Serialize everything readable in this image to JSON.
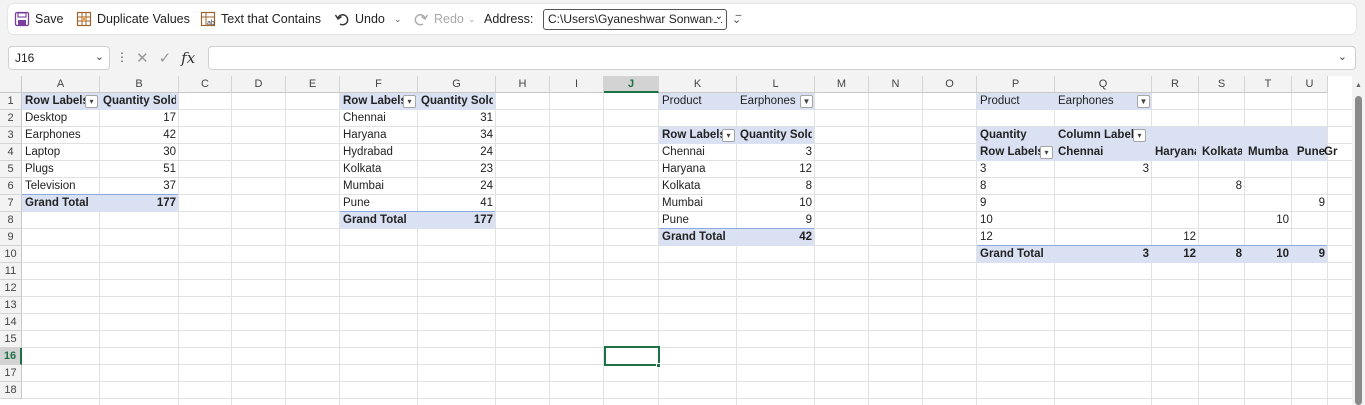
{
  "toolbar": {
    "save": "Save",
    "duplicate_values": "Duplicate Values",
    "text_contains": "Text that Contains",
    "undo": "Undo",
    "redo": "Redo",
    "address_label": "Address:",
    "address_value": "C:\\Users\\Gyaneshwar Sonwane\\"
  },
  "formula_bar": {
    "name_box": "J16",
    "formula": ""
  },
  "columns": [
    "A",
    "B",
    "C",
    "D",
    "E",
    "F",
    "G",
    "H",
    "I",
    "J",
    "K",
    "L",
    "M",
    "N",
    "O",
    "P",
    "Q",
    "R",
    "S",
    "T",
    "U"
  ],
  "rows": [
    "1",
    "2",
    "3",
    "4",
    "5",
    "6",
    "7",
    "8",
    "9",
    "10",
    "11",
    "12",
    "13",
    "14",
    "15",
    "16",
    "17",
    "18"
  ],
  "selected_cell": {
    "column": "J",
    "row": "16"
  },
  "pivot1": {
    "header": [
      "Row Labels",
      "Quantity Sold"
    ],
    "rows": [
      [
        "Desktop",
        "17"
      ],
      [
        "Earphones",
        "42"
      ],
      [
        "Laptop",
        "30"
      ],
      [
        "Plugs",
        "51"
      ],
      [
        "Television",
        "37"
      ]
    ],
    "total": [
      "Grand Total",
      "177"
    ]
  },
  "pivot2": {
    "header": [
      "Row Labels",
      "Quantity Sold"
    ],
    "rows": [
      [
        "Chennai",
        "31"
      ],
      [
        "Haryana",
        "34"
      ],
      [
        "Hydrabad",
        "24"
      ],
      [
        "Kolkata",
        "23"
      ],
      [
        "Mumbai",
        "24"
      ],
      [
        "Pune",
        "41"
      ]
    ],
    "total": [
      "Grand Total",
      "177"
    ]
  },
  "pivot3": {
    "filter": [
      "Product",
      "Earphones"
    ],
    "header": [
      "Row Labels",
      "Quantity Sold"
    ],
    "rows": [
      [
        "Chennai",
        "3"
      ],
      [
        "Haryana",
        "12"
      ],
      [
        "Kolkata",
        "8"
      ],
      [
        "Mumbai",
        "10"
      ],
      [
        "Pune",
        "9"
      ]
    ],
    "total": [
      "Grand Total",
      "42"
    ]
  },
  "pivot4": {
    "filter": [
      "Product",
      "Earphones"
    ],
    "value_label": "Quantity",
    "column_labels": "Column Labels",
    "row_labels": "Row Labels",
    "columns": [
      "Chennai",
      "Haryana",
      "Kolkata",
      "Mumbai",
      "Pune",
      "Gr"
    ],
    "rows": [
      {
        "label": "3",
        "values": [
          "3",
          "",
          "",
          "",
          ""
        ]
      },
      {
        "label": "8",
        "values": [
          "",
          "",
          "8",
          "",
          ""
        ]
      },
      {
        "label": "9",
        "values": [
          "",
          "",
          "",
          "",
          "9"
        ]
      },
      {
        "label": "10",
        "values": [
          "",
          "",
          "",
          "10",
          ""
        ]
      },
      {
        "label": "12",
        "values": [
          "",
          "12",
          "",
          "",
          ""
        ]
      }
    ],
    "total_label": "Grand Total",
    "totals": [
      "3",
      "12",
      "8",
      "10",
      "9"
    ]
  },
  "colors": {
    "accent": "#1e7145",
    "pivot_band": "#d9e1f2"
  }
}
